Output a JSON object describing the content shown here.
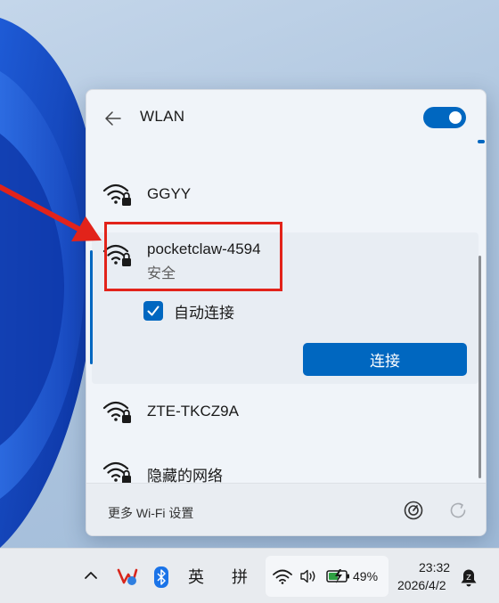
{
  "panel": {
    "title": "WLAN",
    "wifi_enabled": true
  },
  "networks": [
    {
      "name": "GGYY",
      "secured": true
    },
    {
      "name": "pocketclaw-4594",
      "status": "安全",
      "secured": true,
      "expanded": true,
      "auto_connect_label": "自动连接",
      "auto_connect": true,
      "connect_label": "连接"
    },
    {
      "name": "ZTE-TKCZ9A",
      "secured": true
    },
    {
      "name": "隐藏的网络",
      "secured": true
    }
  ],
  "footer": {
    "more_settings": "更多 Wi-Fi 设置"
  },
  "taskbar": {
    "ime_lang": "英",
    "ime_mode": "拼",
    "battery_percent": "49%",
    "time": "23:32",
    "date": "2026/4/2"
  },
  "colors": {
    "accent": "#0067c0",
    "annotation": "#e2231a"
  },
  "icons": [
    "back-arrow-icon",
    "wifi-lock-icon",
    "check-icon",
    "cast-icon",
    "refresh-icon",
    "chevron-up-icon",
    "app-tray-icon",
    "bluetooth-icon",
    "volume-icon",
    "battery-charging-icon",
    "notification-bell-icon"
  ]
}
